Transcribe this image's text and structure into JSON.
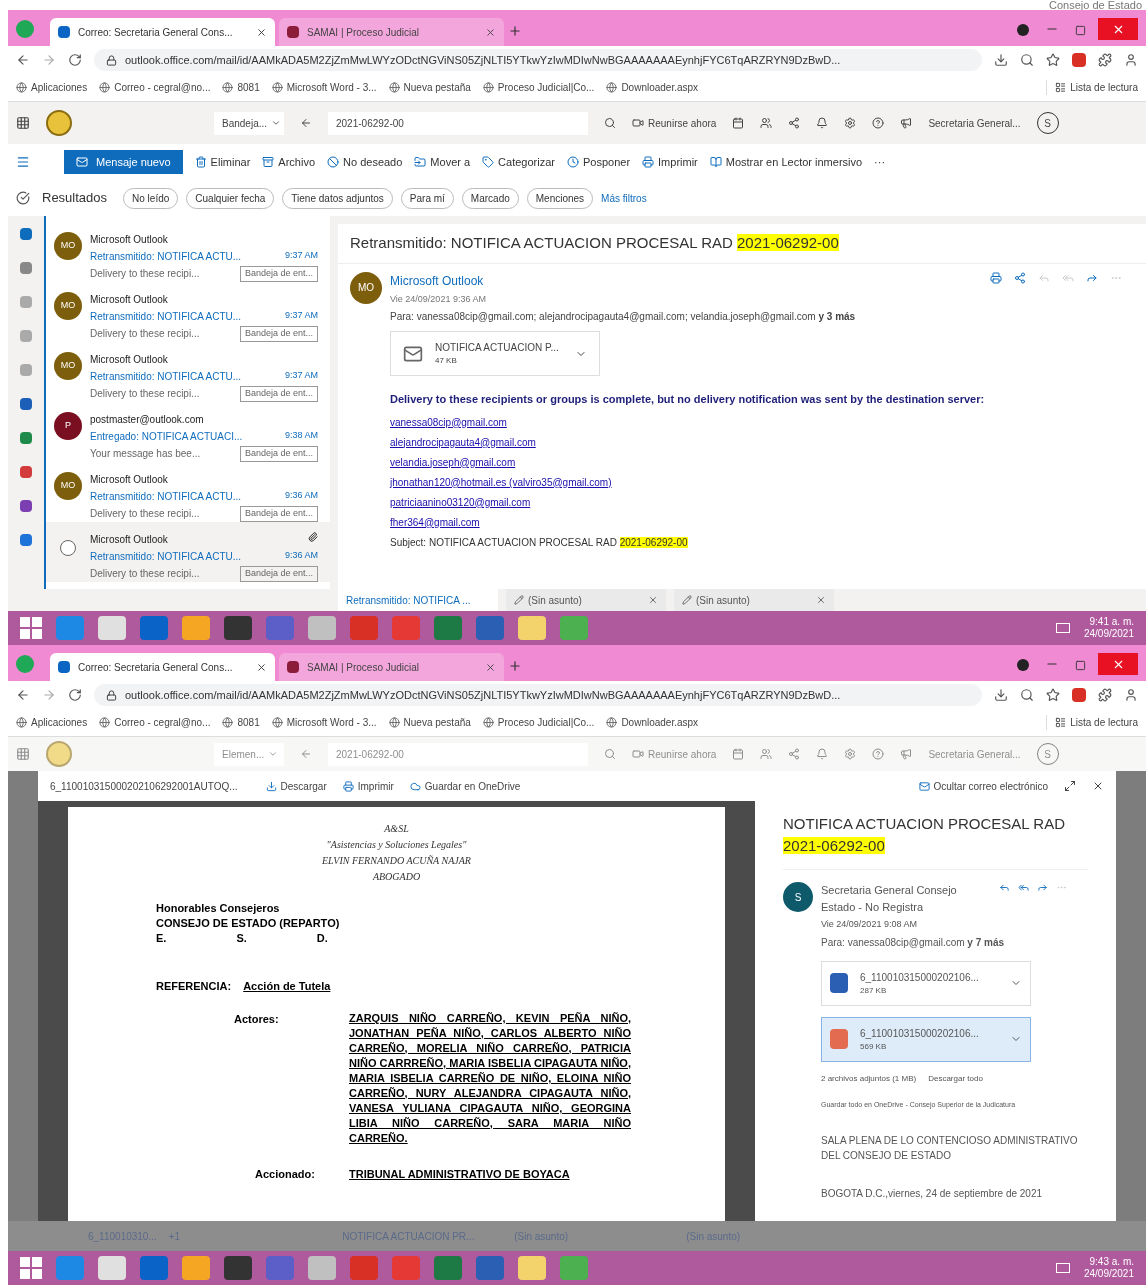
{
  "corner_text": "Consejo de Estado",
  "screens": [
    {
      "kind": "mail",
      "browser": {
        "tabs": [
          {
            "title": "Correo: Secretaria General Cons...",
            "selected": true
          },
          {
            "title": "SAMAI | Proceso Judicial",
            "selected": false
          }
        ],
        "url": "outlook.office.com/mail/id/AAMkADA5M2ZjZmMwLWYzODctNGViNS05ZjNLTI5YTkwYzIwMDIwNwBGAAAAAAAEynhjFYC6TqARZRYN9DzBwD...",
        "bookmarks": [
          "Aplicaciones",
          "Correo - cegral@no...",
          "8081",
          "Microsoft Word - 3...",
          "Nueva pestaña",
          "Proceso Judicial|Co...",
          "Downloader.aspx"
        ],
        "reading_list": "Lista de lectura"
      },
      "outlook": {
        "folder": "Bandeja...",
        "search": "2021-06292-00",
        "meet": "Reunirse ahora",
        "account": "Secretaria General...",
        "avatar": "S"
      },
      "toolbar": {
        "new": "Mensaje nuevo",
        "actions": [
          "Eliminar",
          "Archivo",
          "No deseado",
          "Mover a",
          "Categorizar",
          "Posponer",
          "Imprimir",
          "Mostrar en Lector inmersivo"
        ],
        "more": "···"
      },
      "filters": {
        "title": "Resultados",
        "chips": [
          "No leído",
          "Cualquier fecha",
          "Tiene datos adjuntos",
          "Para mí",
          "Marcado",
          "Menciones"
        ],
        "more": "Más filtros"
      },
      "messages": [
        {
          "initials": "MO",
          "color": "#7d5e0c",
          "sender": "Microsoft Outlook",
          "subject": "Retransmitido: NOTIFICA ACTU...",
          "time": "9:37 AM",
          "preview": "Delivery to these recipi...",
          "folder": "Bandeja de ent...",
          "hovered": false
        },
        {
          "initials": "MO",
          "color": "#7d5e0c",
          "sender": "Microsoft Outlook",
          "subject": "Retransmitido: NOTIFICA ACTU...",
          "time": "9:37 AM",
          "preview": "Delivery to these recipi...",
          "folder": "Bandeja de ent...",
          "hovered": false
        },
        {
          "initials": "MO",
          "color": "#7d5e0c",
          "sender": "Microsoft Outlook",
          "subject": "Retransmitido: NOTIFICA ACTU...",
          "time": "9:37 AM",
          "preview": "Delivery to these recipi...",
          "folder": "Bandeja de ent...",
          "hovered": false
        },
        {
          "initials": "P",
          "color": "#7a0f22",
          "sender": "postmaster@outlook.com",
          "subject": "Entregado: NOTIFICA ACTUACI...",
          "time": "9:38 AM",
          "preview": "Your message has bee...",
          "folder": "Bandeja de ent...",
          "hovered": false
        },
        {
          "initials": "MO",
          "color": "#7d5e0c",
          "sender": "Microsoft Outlook",
          "subject": "Retransmitido: NOTIFICA ACTU...",
          "time": "9:36 AM",
          "preview": "Delivery to these recipi...",
          "folder": "Bandeja de ent...",
          "hovered": false
        },
        {
          "sender": "Microsoft Outlook",
          "subject": "Retransmitido: NOTIFICA ACTU...",
          "time": "9:36 AM",
          "preview": "Delivery to these recipi...",
          "folder": "Bandeja de ent...",
          "hovered": true
        }
      ],
      "reading": {
        "subject": "Retransmitido: NOTIFICA ACTUACION PROCESAL RAD",
        "subject_highlight": "2021-06292-00",
        "initials": "MO",
        "sender": "Microsoft Outlook",
        "date": "Vie 24/09/2021 9:36 AM",
        "to": "Para: vanessa08cip@gmail.com; alejandrocipagauta4@gmail.com; velandia.joseph@gmail.com **y 3 más**",
        "attachment": {
          "name": "NOTIFICA ACTUACION P...",
          "size": "47 KB"
        },
        "notice": "Delivery to these recipients or groups is complete, but no delivery notification was sent by the destination server:",
        "links": [
          "vanessa08cip@gmail.com",
          "alejandrocipagauta4@gmail.com",
          "velandia.joseph@gmail.com",
          "jhonathan120@hotmail.es (valviro35@gmail.com)",
          "patriciaanino03120@gmail.com",
          "fher364@gmail.com"
        ],
        "subject_line": "Subject: NOTIFICA ACTUACION PROCESAL RAD",
        "subject_line_highlight": "2021-06292-00"
      },
      "bottom_tabs": [
        {
          "kind": "message",
          "title": "Retransmitido: NOTIFICA ...",
          "selected": true
        },
        {
          "kind": "draft",
          "title": "(Sin asunto)",
          "selected": false
        },
        {
          "kind": "draft",
          "title": "(Sin asunto)",
          "selected": false
        }
      ],
      "clock": {
        "time": "9:41 a. m.",
        "date": "24/09/2021"
      }
    },
    {
      "kind": "viewer",
      "browser": {
        "tabs": [
          {
            "title": "Correo: Secretaria General Cons...",
            "selected": true
          },
          {
            "title": "SAMAI | Proceso Judicial",
            "selected": false
          }
        ],
        "url": "outlook.office.com/mail/id/AAMkADA5M2ZjZmMwLWYzODctNGViNS05ZjNLTI5YTkwYzIwMDIwNwBGAAAAAAAEynhjFYC6TqARZRYN9DzBwD...",
        "bookmarks": [
          "Aplicaciones",
          "Correo - cegral@no...",
          "8081",
          "Microsoft Word - 3...",
          "Nueva pestaña",
          "Proceso Judicial|Co...",
          "Downloader.aspx"
        ],
        "reading_list": "Lista de lectura"
      },
      "outlook": {
        "folder": "Elemen...",
        "search": "2021-06292-00",
        "meet": "Reunirse ahora",
        "account": "Secretaria General...",
        "avatar": "S"
      },
      "viewer": {
        "file": "6_110010315000202106292001AUTOQ...",
        "actions": [
          "Descargar",
          "Imprimir",
          "Guardar en OneDrive"
        ],
        "hide": "Ocultar correo electrónico"
      },
      "document": {
        "letterhead": [
          "A&SL",
          "\"Asistencias y Soluciones Legales\"",
          "ELVIN FERNANDO ACUÑA NAJAR",
          "ABOGADO"
        ],
        "address": [
          "Honorables Consejeros",
          "CONSEJO DE ESTADO (REPARTO)"
        ],
        "esd": [
          "E.",
          "S.",
          "D."
        ],
        "ref_label": "REFERENCIA:",
        "ref_value": "Acción de Tutela",
        "actors_label": "Actores:",
        "actors": "ZARQUIS NIÑO CARREÑO, KEVIN PEÑA NIÑO, JONATHAN PEÑA NIÑO, CARLOS ALBERTO NIÑO CARREÑO, MORELIA NIÑO CARREÑO, PATRICIA NIÑO CARRREÑO, MARIA ISBELIA CIPAGAUTA NIÑO, MARIA ISBELIA CARREÑO DE NIÑO, ELOINA NIÑO CARREÑO, NURY ALEJANDRA CIPAGAUTA NIÑO, VANESA YULIANA CIPAGAUTA NIÑO, GEORGINA LIBIA NIÑO CARREÑO, SARA MARIA NIÑO CARREÑO.",
        "defendant_label": "Accionado:",
        "defendant": "TRIBUNAL ADMINISTRATIVO DE BOYACA"
      },
      "panel": {
        "subject": "NOTIFICA ACTUACION PROCESAL RAD",
        "subject_highlight": "2021-06292-00",
        "initials": "S",
        "sender": "Secretaria General Consejo Estado - No Registra",
        "date": "Vie 24/09/2021 9:08 AM",
        "to": "Para: vanessa08cip@gmail.com **y 7 más**",
        "attachments": [
          {
            "kind": "word",
            "name": "6_110010315000202106...",
            "size": "287 KB",
            "selected": false
          },
          {
            "kind": "pdf",
            "name": "6_110010315000202106...",
            "size": "569 KB",
            "selected": true
          }
        ],
        "summary": "2 archivos adjuntos (1 MB)",
        "download_all": "Descargar todo",
        "save_all": "Guardar todo en OneDrive - Consejo Superior de la Judicatura",
        "body": [
          "SALA PLENA DE LO CONTENCIOSO ADMINISTRATIVO DEL CONSEJO DE ESTADO",
          "BOGOTA D.C.,viernes, 24 de septiembre de 2021"
        ]
      },
      "bottom_strip": {
        "file": "6_110010310...",
        "extra": "+1",
        "tabs": [
          "NOTIFICA ACTUACION PR...",
          "(Sin asunto)",
          "(Sin asunto)"
        ]
      },
      "clock": {
        "time": "9:43 a. m.",
        "date": "24/09/2021"
      }
    }
  ]
}
